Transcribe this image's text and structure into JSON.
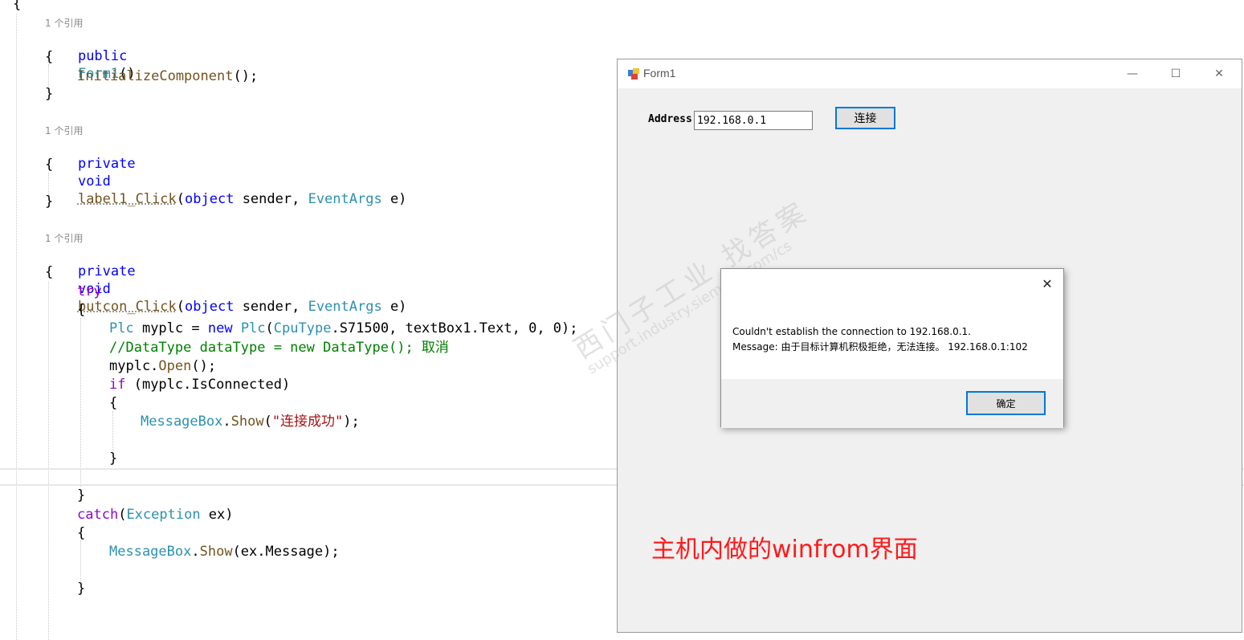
{
  "editor": {
    "open_brace_top": "{",
    "refs": {
      "r1": "1 个引用",
      "r2": "1 个引用",
      "r3": "1 个引用"
    },
    "form1": {
      "kw": "public",
      "name": "Form1",
      "paren": "()"
    },
    "brace": "{",
    "brace_close": "}",
    "init_call": "InitializeComponent",
    "init_tail": "();",
    "label1": {
      "kw1": "private",
      "kw2": "void",
      "name": "label1_Click",
      "open": "(",
      "obj": "object",
      "sender": " sender, ",
      "eargs": "EventArgs",
      "tail": " e)"
    },
    "butcon": {
      "kw1": "private",
      "kw2": "void",
      "name": "butcon_Click",
      "open": "(",
      "obj": "object",
      "sender": " sender, ",
      "eargs": "EventArgs",
      "tail": " e)"
    },
    "try_kw": "try",
    "plc_line": {
      "ty1": "Plc",
      "v1": " myplc = ",
      "kw": "new",
      "sp": " ",
      "ty2": "Plc",
      "open": "(",
      "ty3": "CpuType",
      "dot": ".",
      "fld": "S71500",
      "rest": ", textBox1.Text, 0, 0);"
    },
    "comment": "//DataType dataType = new DataType(); 取消",
    "open_line": {
      "obj": "myplc.",
      "fn": "Open",
      "tail": "();"
    },
    "if_line": {
      "kw": "if",
      "rest": " (myplc.IsConnected)"
    },
    "msg_success": {
      "ty": "MessageBox",
      "dot": ".",
      "fn": "Show",
      "open": "(",
      "str": "\"连接成功\"",
      "tail": ");"
    },
    "catch_line": {
      "kw": "catch",
      "open": "(",
      "ty": "Exception",
      "tail": " ex)"
    },
    "msg_ex": {
      "ty": "MessageBox",
      "dot": ".",
      "fn": "Show",
      "tail": "(ex.Message);"
    }
  },
  "window": {
    "title": "Form1",
    "minimize_glyph": "—",
    "maximize_glyph": "☐",
    "close_glyph": "✕",
    "address_label": "Address",
    "address_value": "192.168.0.1",
    "connect_label": "连接",
    "caption": "主机内做的winfrom界面"
  },
  "dialog": {
    "line1": "Couldn't establish the connection to 192.168.0.1.",
    "line2": "Message: 由于目标计算机积极拒绝，无法连接。 192.168.0.1:102",
    "ok_label": "确定",
    "close_glyph": "✕"
  },
  "watermark": {
    "cn": "西门子工业  找答案",
    "url": "support.industry.siemens.com/cs"
  },
  "colors": {
    "keyword": "#0000ff",
    "type": "#2b91af",
    "method": "#74531f",
    "control": "#8f08c4",
    "comment": "#008000",
    "string": "#a31515",
    "caption": "#ff1a1a",
    "focus_border": "#0078d7"
  }
}
